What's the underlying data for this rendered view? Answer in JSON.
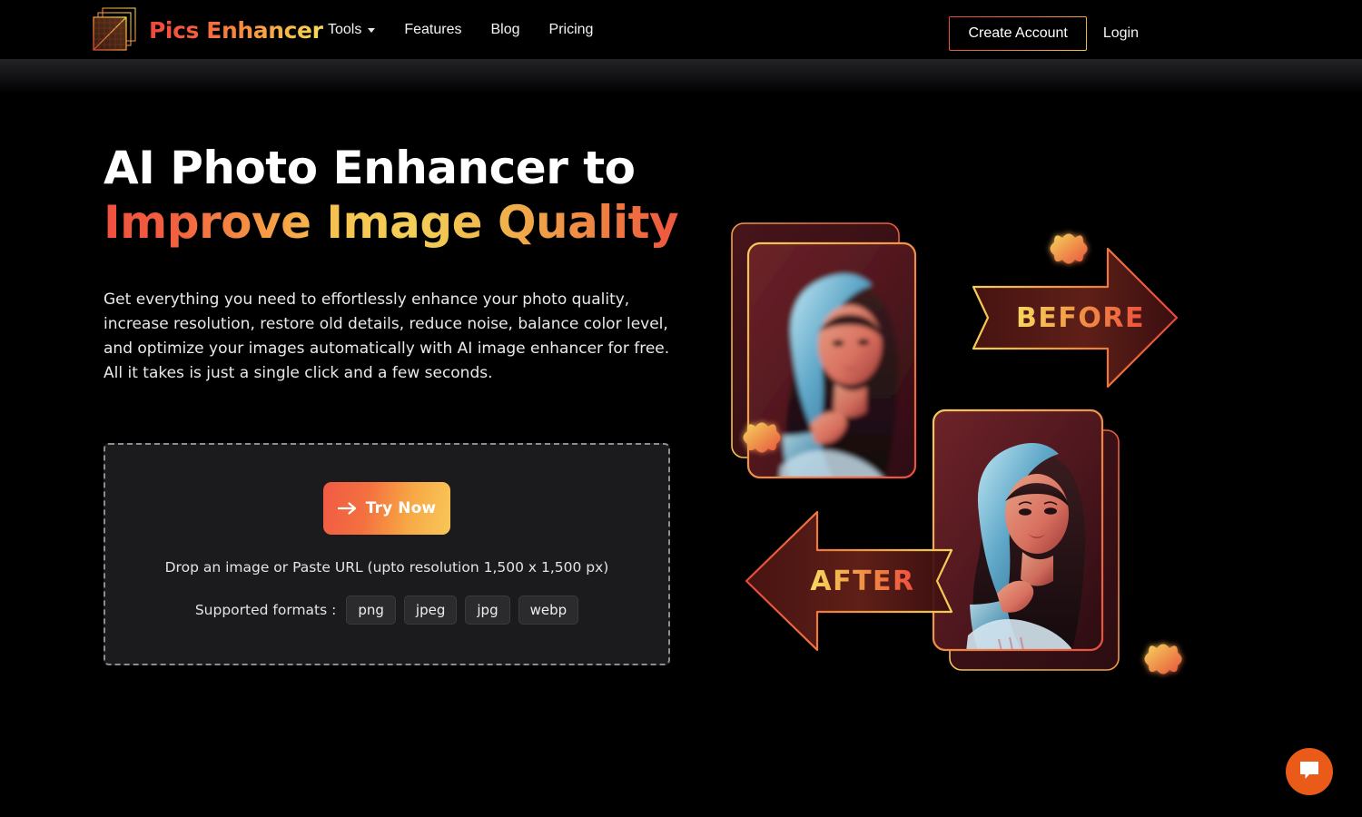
{
  "brand": {
    "name": "Pics Enhancer",
    "logo_icon": "stacked-frames-icon"
  },
  "nav": {
    "items": [
      {
        "label": "Tools",
        "has_dropdown": true
      },
      {
        "label": "Features",
        "has_dropdown": false
      },
      {
        "label": "Blog",
        "has_dropdown": false
      },
      {
        "label": "Pricing",
        "has_dropdown": false
      }
    ]
  },
  "auth": {
    "create_account_label": "Create Account",
    "login_label": "Login"
  },
  "hero": {
    "heading_line1": "AI Photo Enhancer to",
    "heading_line2": "Improve Image Quality",
    "paragraph": "Get everything you need to effortlessly enhance your photo quality, increase resolution, restore old details, reduce noise, balance color level, and optimize your images automatically with AI image enhancer for free. All it takes is just a single click and a few seconds."
  },
  "dropzone": {
    "try_now_label": "Try Now",
    "try_now_icon": "arrow-right-icon",
    "hint": "Drop an image or Paste URL (upto resolution 1,500 x 1,500 px)",
    "formats_label": "Supported formats :",
    "formats": [
      "png",
      "jpeg",
      "jpg",
      "webp"
    ]
  },
  "hero_art": {
    "before_label": "BEFORE",
    "after_label": "AFTER",
    "before_arrow_icon": "arrow-right-banner-icon",
    "after_arrow_icon": "arrow-left-banner-icon",
    "sparkle_icon": "four-point-star-icon",
    "sparkle_count": 3,
    "card_before_name": "photo-card-before",
    "card_after_name": "photo-card-after"
  },
  "chat": {
    "icon": "chat-bubble-icon",
    "aria_label": "Open chat"
  },
  "colors": {
    "page_bg": "#000000",
    "accent_red": "#ef4b3c",
    "accent_orange": "#f2803f",
    "accent_yellow": "#f5c94f",
    "chat_orange": "#ea5a19",
    "dropzone_bg": "#1b1b1d",
    "chip_bg": "#2b2b2e"
  }
}
